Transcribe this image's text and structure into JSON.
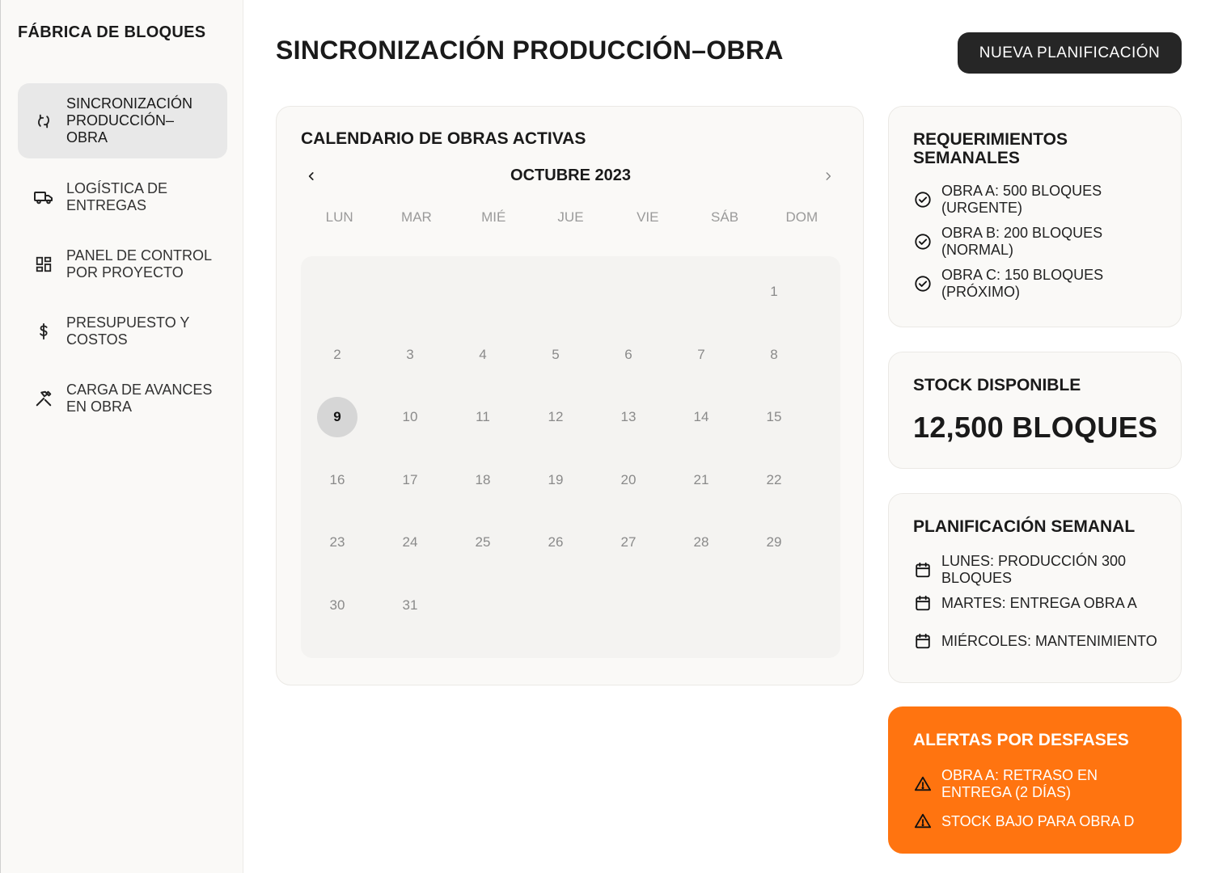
{
  "sidebar": {
    "brand": "FÁBRICA DE BLOQUES",
    "items": [
      {
        "label": "SINCRONIZACIÓN PRODUCCIÓN–OBRA",
        "icon": "sync-icon",
        "active": true
      },
      {
        "label": "LOGÍSTICA DE ENTREGAS",
        "icon": "truck-icon",
        "active": false
      },
      {
        "label": "PANEL DE CONTROL POR PROYECTO",
        "icon": "dashboard-icon",
        "active": false
      },
      {
        "label": "PRESUPUESTO Y COSTOS",
        "icon": "dollar-icon",
        "active": false
      },
      {
        "label": "CARGA DE AVANCES EN OBRA",
        "icon": "tools-icon",
        "active": false
      }
    ]
  },
  "header": {
    "title": "SINCRONIZACIÓN PRODUCCIÓN–OBRA",
    "new_button": "NUEVA PLANIFICACIÓN"
  },
  "calendar": {
    "title": "CALENDARIO DE OBRAS ACTIVAS",
    "month": "OCTUBRE 2023",
    "weekdays": [
      "LUN",
      "MAR",
      "MIÉ",
      "JUE",
      "VIE",
      "SÁB",
      "DOM"
    ],
    "first_weekday_index": 6,
    "days_in_month": 31,
    "selected_day": 9
  },
  "requirements": {
    "title": "REQUERIMIENTOS SEMANALES",
    "items": [
      "OBRA A: 500 BLOQUES (URGENTE)",
      "OBRA B: 200 BLOQUES (NORMAL)",
      "OBRA C: 150 BLOQUES (PRÓXIMO)"
    ]
  },
  "stock": {
    "title": "STOCK DISPONIBLE",
    "value": "12,500 BLOQUES"
  },
  "planning": {
    "title": "PLANIFICACIÓN SEMANAL",
    "items": [
      "LUNES: PRODUCCIÓN 300 BLOQUES",
      "MARTES: ENTREGA OBRA A",
      "MIÉRCOLES: MANTENIMIENTO"
    ]
  },
  "alerts": {
    "title": "ALERTAS POR DESFASES",
    "items": [
      "OBRA A: RETRASO EN ENTREGA (2 DÍAS)",
      "STOCK BAJO PARA OBRA D"
    ]
  },
  "colors": {
    "accent": "#ff7410",
    "button_dark": "#262626",
    "card_bg": "#faf9f7"
  }
}
